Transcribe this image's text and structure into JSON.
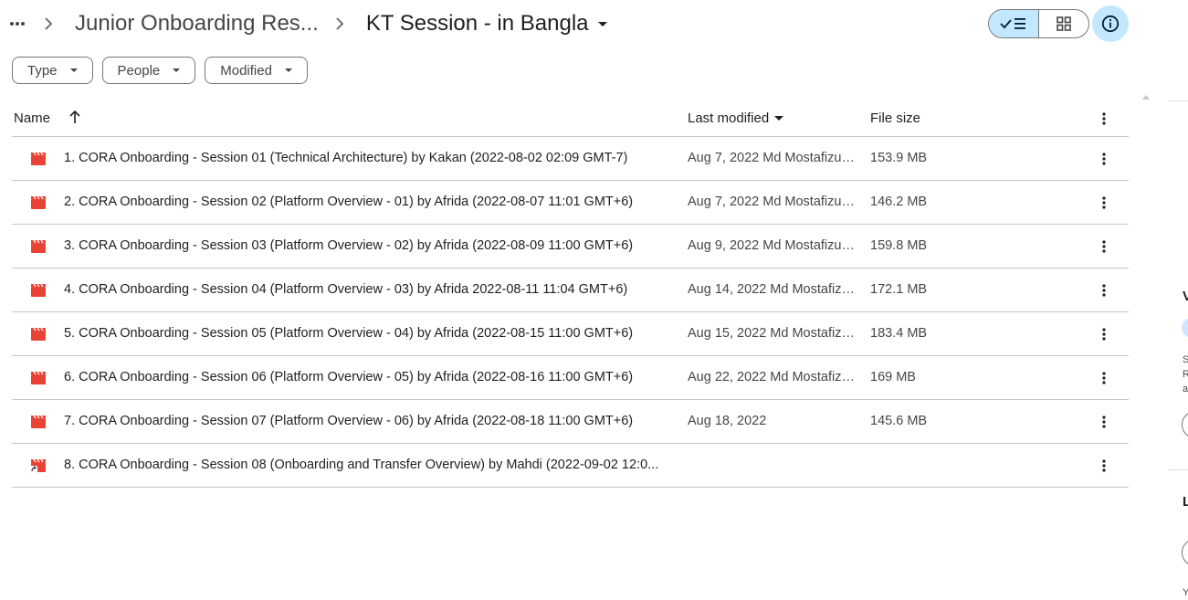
{
  "breadcrumb": {
    "more_label": "•••",
    "parent": "Junior Onboarding Res...",
    "current": "KT Session - in Bangla"
  },
  "filters": [
    {
      "label": "Type"
    },
    {
      "label": "People"
    },
    {
      "label": "Modified"
    }
  ],
  "table": {
    "columns": {
      "name": "Name",
      "last_modified": "Last modified",
      "file_size": "File size"
    },
    "rows": [
      {
        "name": "1. CORA Onboarding - Session 01 (Technical Architecture) by Kakan (2022-08-02 02:09 GMT-7)",
        "modified": "Aug 7, 2022 Md Mostafizur ...",
        "size": "153.9 MB",
        "icon": "video-file-icon"
      },
      {
        "name": "2. CORA Onboarding - Session 02 (Platform Overview - 01) by Afrida (2022-08-07 11:01 GMT+6)",
        "modified": "Aug 7, 2022 Md Mostafizur ...",
        "size": "146.2 MB",
        "icon": "video-file-icon"
      },
      {
        "name": "3. CORA Onboarding - Session 03 (Platform Overview - 02) by Afrida (2022-08-09 11:00 GMT+6)",
        "modified": "Aug 9, 2022 Md Mostafizur ...",
        "size": "159.8 MB",
        "icon": "video-file-icon"
      },
      {
        "name": "4. CORA Onboarding - Session 04 (Platform Overview - 03) by Afrida  2022-08-11 11:04 GMT+6)",
        "modified": "Aug 14, 2022 Md Mostafizur...",
        "size": "172.1 MB",
        "icon": "video-file-icon"
      },
      {
        "name": "5. CORA Onboarding - Session 05 (Platform Overview - 04) by Afrida (2022-08-15 11:00 GMT+6)",
        "modified": "Aug 15, 2022 Md Mostafizur...",
        "size": "183.4 MB",
        "icon": "video-file-icon"
      },
      {
        "name": "6. CORA Onboarding - Session 06 (Platform Overview - 05) by Afrida (2022-08-16 11:00 GMT+6)",
        "modified": "Aug 22, 2022 Md Mostafizu...",
        "size": "169 MB",
        "icon": "video-file-icon"
      },
      {
        "name": "7. CORA Onboarding - Session 07 (Platform Overview - 06) by Afrida (2022-08-18 11:00 GMT+6)",
        "modified": "Aug 18, 2022",
        "size": "145.6 MB",
        "icon": "video-file-icon"
      },
      {
        "name": "8. CORA Onboarding - Session 08 (Onboarding and Transfer Overview) by Mahdi (2022-09-02 12:0...",
        "modified": "",
        "size": "",
        "icon": "video-shortcut-icon"
      }
    ]
  },
  "side_panel": {
    "letters": [
      "V",
      "L"
    ],
    "snippets": [
      "S",
      "R",
      "a",
      "Y"
    ]
  },
  "colors": {
    "accent_light": "#c2e7ff",
    "video_icon": "#ea4335",
    "divider": "#c7c7c7"
  }
}
